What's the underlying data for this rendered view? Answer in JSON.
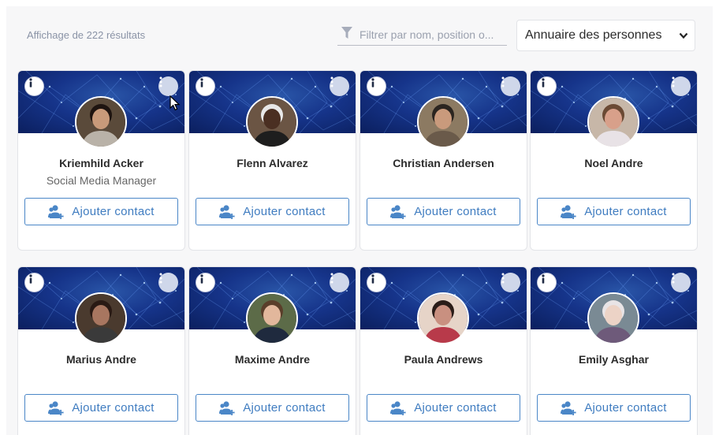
{
  "toolbar": {
    "results_text": "Affichage de 222 résultats",
    "filter_placeholder": "Filtrer par nom, position o...",
    "directory_selected": "Annuaire des personnes"
  },
  "card_button_label": "Ajouter contact",
  "people": [
    {
      "name": "Kriemhild Acker",
      "position": "Social Media Manager",
      "skin": "#c89a7a",
      "hair": "#1e1410",
      "bg": "#5a4a3a",
      "shirt": "#b9b2a8"
    },
    {
      "name": "Flenn Alvarez",
      "position": "",
      "skin": "#4a2f22",
      "hair": "#e8e8e8",
      "bg": "#6b5544",
      "shirt": "#1e1e1e"
    },
    {
      "name": "Christian Andersen",
      "position": "",
      "skin": "#c99a7c",
      "hair": "#2b2520",
      "bg": "#8c7a62",
      "shirt": "#6a5a4a"
    },
    {
      "name": "Noel Andre",
      "position": "",
      "skin": "#d8a08a",
      "hair": "#6b4a34",
      "bg": "#c7b7a8",
      "shirt": "#e8e2e6"
    },
    {
      "name": "Marius Andre",
      "position": "",
      "skin": "#a87660",
      "hair": "#2a1a14",
      "bg": "#4a3a2e",
      "shirt": "#3a3a3a"
    },
    {
      "name": "Maxime Andre",
      "position": "",
      "skin": "#e2b79c",
      "hair": "#5a3e2a",
      "bg": "#5c6b48",
      "shirt": "#1f2a3e"
    },
    {
      "name": "Paula Andrews",
      "position": "",
      "skin": "#c99080",
      "hair": "#2a1c18",
      "bg": "#e6d4c8",
      "shirt": "#b83a4a"
    },
    {
      "name": "Emily Asghar",
      "position": "",
      "skin": "#ecd3c6",
      "hair": "#e8e4e6",
      "bg": "#7a8a94",
      "shirt": "#6e5a7a"
    }
  ]
}
